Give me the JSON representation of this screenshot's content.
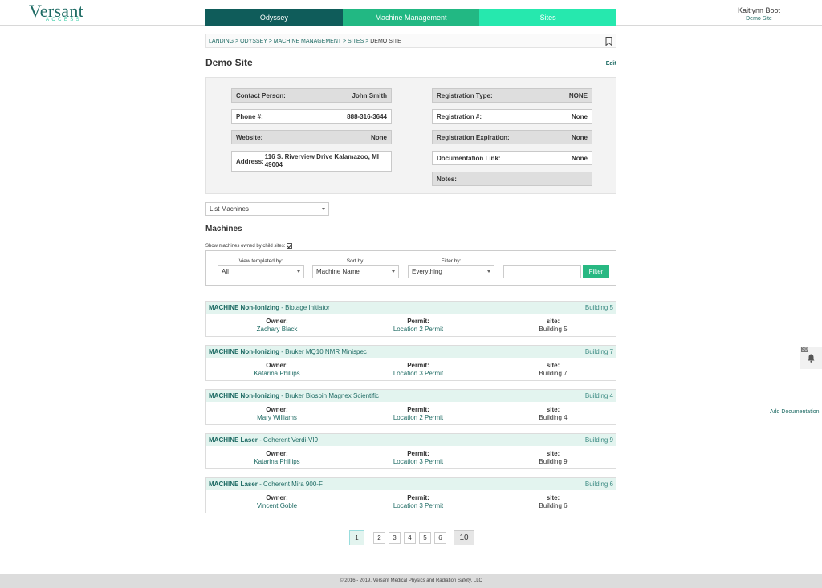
{
  "brand": {
    "name": "Versant",
    "sub": "ACCESS"
  },
  "nav": [
    "Odyssey",
    "Machine Management",
    "Sites"
  ],
  "user": {
    "name": "Kaitlynn Boot",
    "site": "Demo Site"
  },
  "breadcrumb": {
    "path": "LANDING > ODYSSEY > MACHINE MANAGEMENT > SITES > ",
    "current": "DEMO SITE"
  },
  "page": {
    "title": "Demo Site",
    "edit": "Edit"
  },
  "details": {
    "contact": {
      "label": "Contact Person:",
      "value": "John Smith"
    },
    "phone": {
      "label": "Phone #:",
      "value": "888-316-3644"
    },
    "website": {
      "label": "Website:",
      "value": "None"
    },
    "address": {
      "label": "Address:",
      "value": "116 S. Riverview Drive Kalamazoo, MI 49004"
    },
    "reg_type": {
      "label": "Registration Type:",
      "value": "NONE"
    },
    "reg_num": {
      "label": "Registration #:",
      "value": "None"
    },
    "reg_exp": {
      "label": "Registration Expiration:",
      "value": "None"
    },
    "doc_link": {
      "label": "Documentation Link:",
      "value": "None"
    },
    "notes": {
      "label": "Notes:",
      "value": ""
    }
  },
  "list_select": "List Machines",
  "machines_heading": "Machines",
  "child_sites_label": "Show machines owned by child sites:",
  "filters": {
    "view_label": "View templated by:",
    "view_value": "All",
    "sort_label": "Sort by:",
    "sort_value": "Machine Name",
    "filter_label": "Filter by:",
    "filter_value": "Everything",
    "button": "Filter"
  },
  "field_labels": {
    "owner": "Owner:",
    "permit": "Permit:",
    "site": "site:"
  },
  "machines": [
    {
      "type": "MACHINE Non-Ionizing",
      "name": " - Biotage Initiator",
      "building": "Building 5",
      "owner": "Zachary Black",
      "permit": "Location 2 Permit",
      "site": "Building 5"
    },
    {
      "type": "MACHINE Non-Ionizing",
      "name": " - Bruker MQ10 NMR Minispec",
      "building": "Building 7",
      "owner": "Katarina Phillips",
      "permit": "Location 3 Permit",
      "site": "Building 7"
    },
    {
      "type": "MACHINE Non-Ionizing",
      "name": " - Bruker Biospin Magnex Scientific",
      "building": "Building 4",
      "owner": "Mary Williams",
      "permit": "Location 2 Permit",
      "site": "Building 4"
    },
    {
      "type": "MACHINE Laser",
      "name": " - Coherent Verdi-VI9",
      "building": "Building 9",
      "owner": "Katarina Phillips",
      "permit": "Location 3 Permit",
      "site": "Building 9"
    },
    {
      "type": "MACHINE Laser",
      "name": " - Coherent Mira 900-F",
      "building": "Building 6",
      "owner": "Vincent Goble",
      "permit": "Location 3 Permit",
      "site": "Building 6"
    }
  ],
  "pagination": [
    "1",
    "2",
    "3",
    "4",
    "5",
    "6",
    "10"
  ],
  "notifications": {
    "count": "30"
  },
  "add_documentation": "Add Documentation",
  "footer": "© 2016 - 2019, Versant Medical Physics and Radiation Safety, LLC"
}
